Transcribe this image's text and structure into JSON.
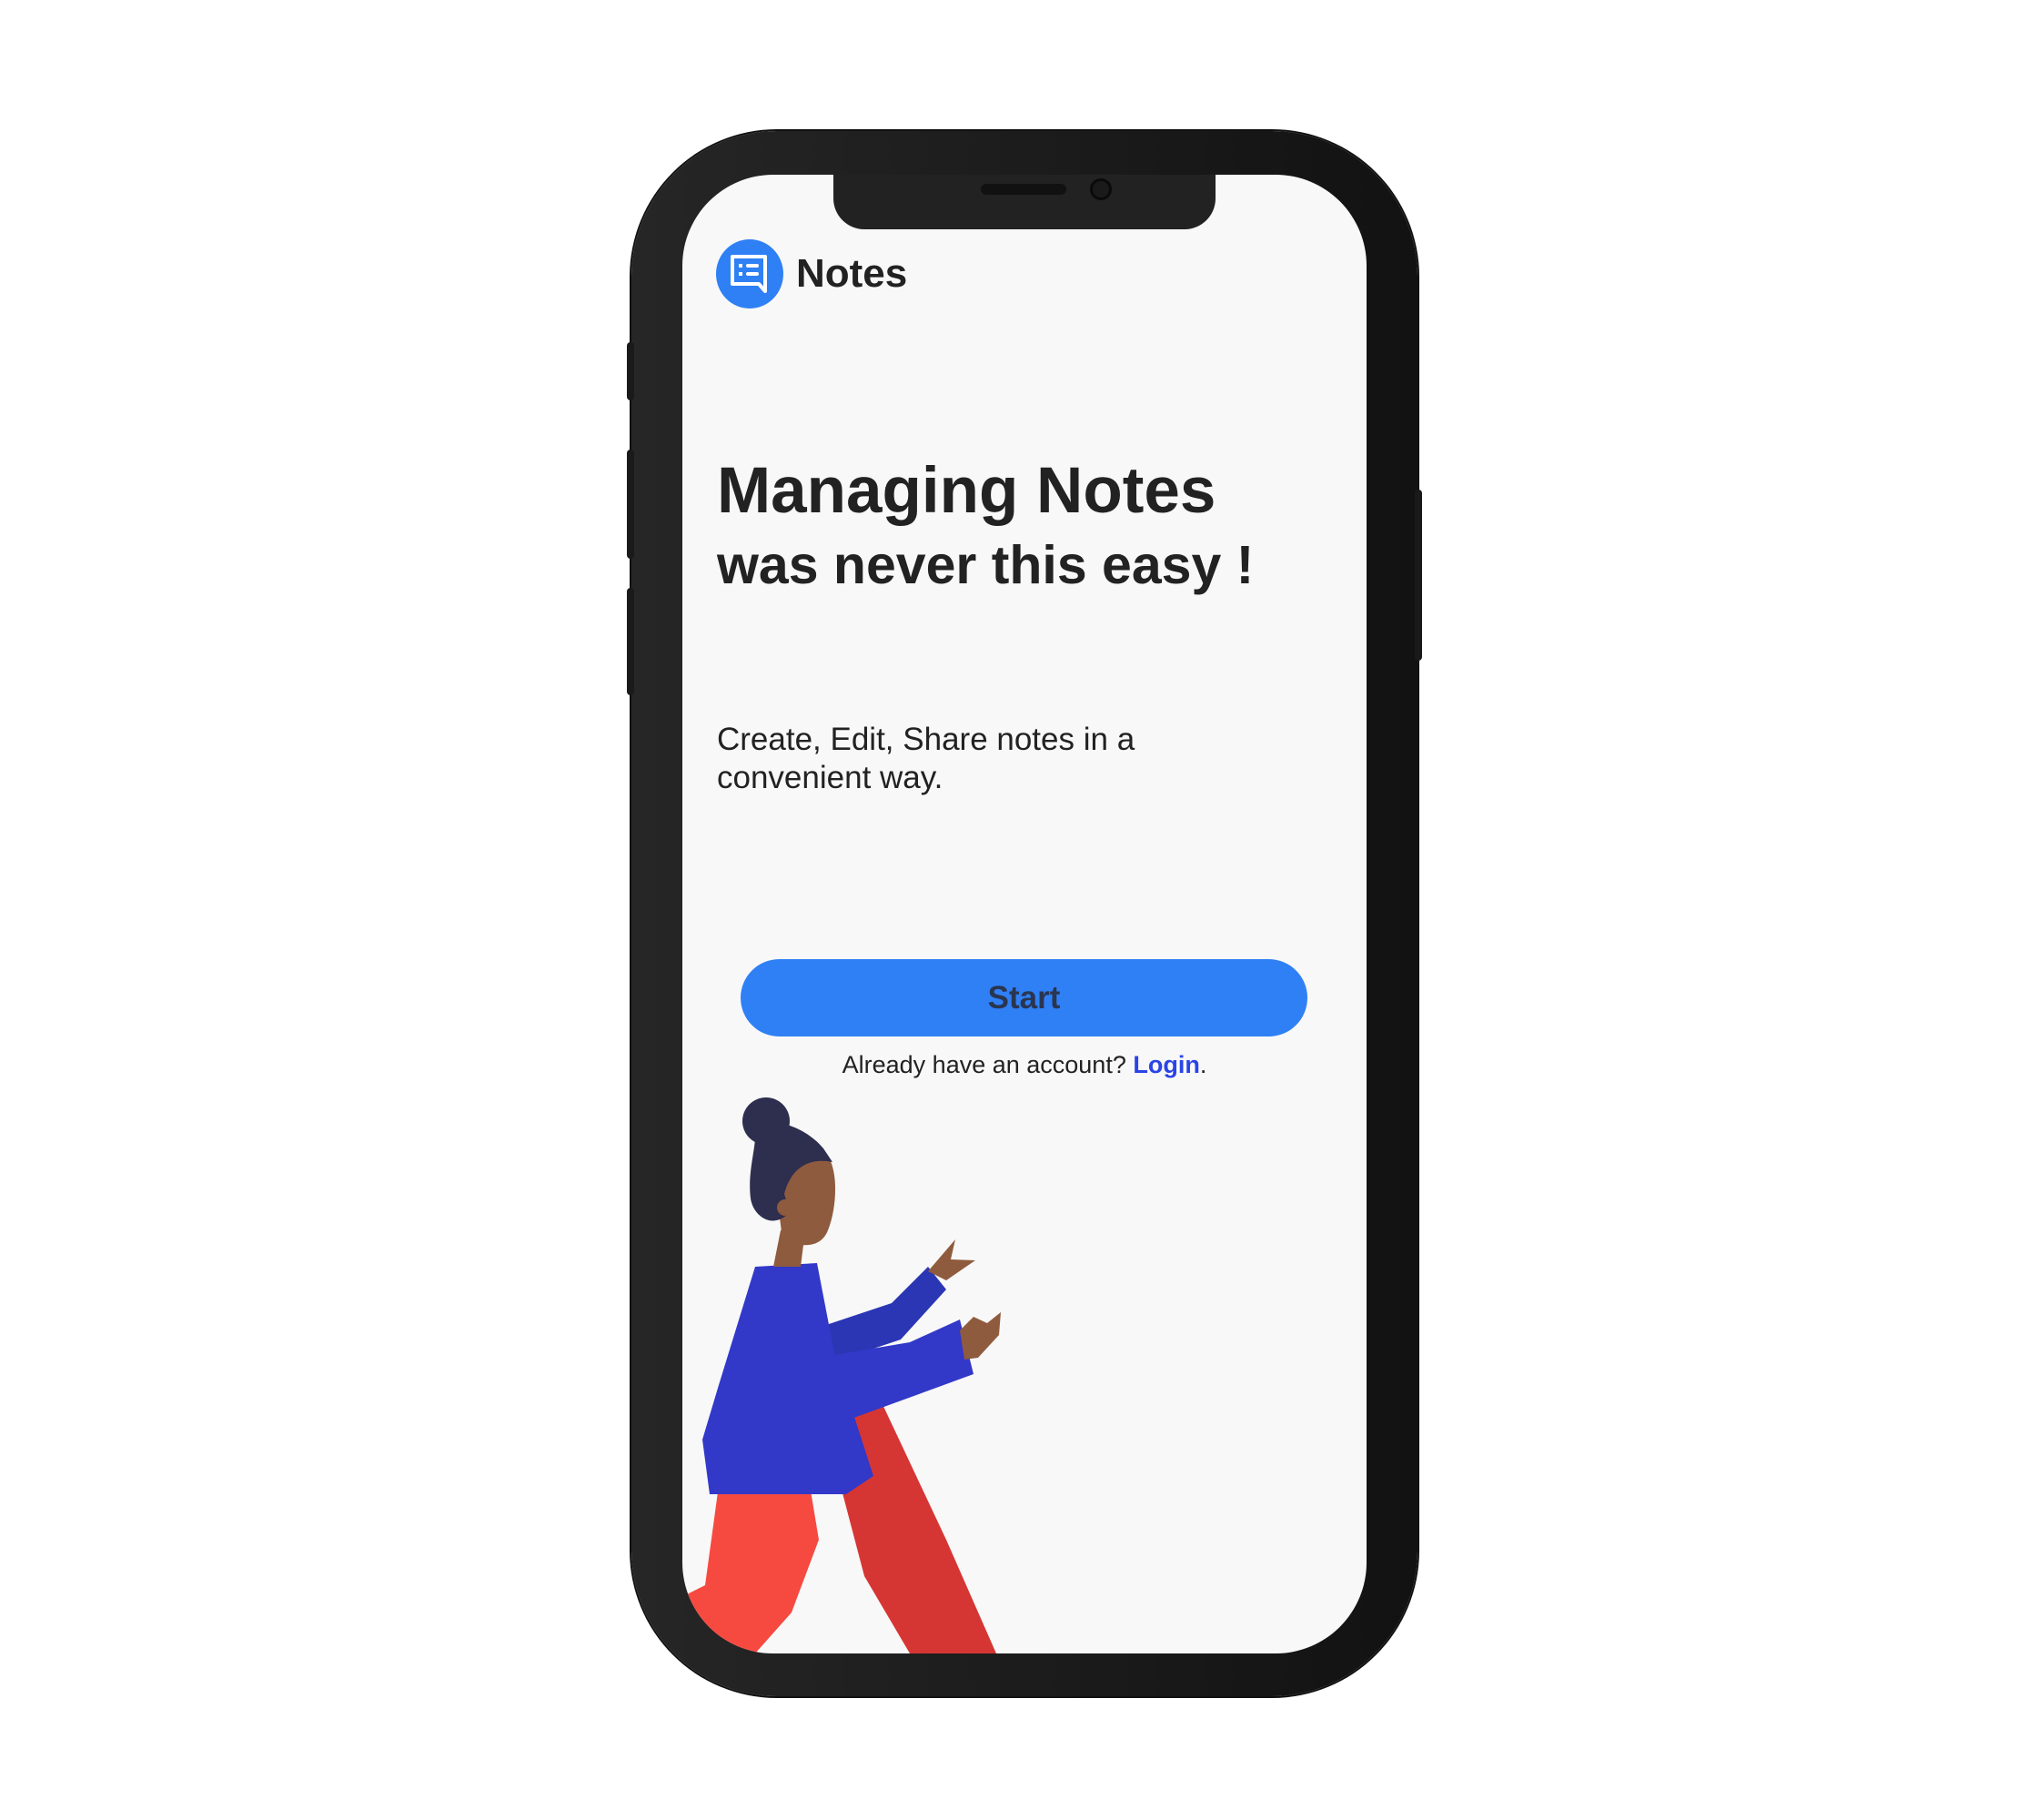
{
  "app": {
    "name": "Notes",
    "logo_icon": "chat-list-icon"
  },
  "hero": {
    "title_line1": "Managing Notes",
    "title_line2": "was never this easy !",
    "subtitle": "Create, Edit, Share notes in a convenient way."
  },
  "actions": {
    "start_label": "Start",
    "login_prompt": "Already have an account?",
    "login_label": "Login",
    "login_suffix": "."
  },
  "colors": {
    "accent": "#2f80f5",
    "link": "#2a44e6",
    "text": "#222222",
    "background": "#f8f8f8"
  }
}
